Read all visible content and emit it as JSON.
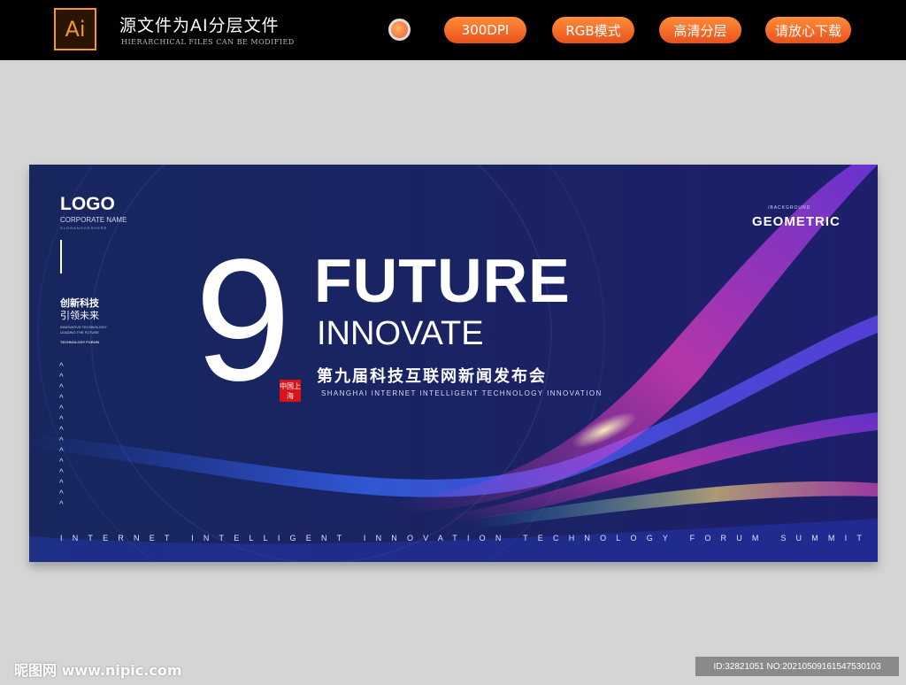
{
  "topbar": {
    "ai_icon_label": "Ai",
    "title": "源文件为AI分层文件",
    "subtitle": "HIERARCHICAL FILES CAN BE MODIFIED",
    "pills": [
      "300DPI",
      "RGB模式",
      "高清分层",
      "请放心下载"
    ]
  },
  "banner": {
    "logo": "LOGO",
    "corporate_name": "CORPORATE NAME",
    "slogan": "SLOGANGOESHERE",
    "cn_line1": "创新科技",
    "cn_line2": "引领未来",
    "small_line1": "INNOVATIVE TECHNOLOGY",
    "small_line2": "LEADING THE FUTURE",
    "small_line3": "TECHNOLOGY FORUM",
    "number": "9",
    "headline": "FUTURE",
    "subheadline": "INNOVATE",
    "cn_title": "第九届科技互联网新闻发布会",
    "en_subtitle": "SHANGHAI INTERNET INTELLIGENT TECHNOLOGY INNOVATION",
    "seal_text": "中国上海",
    "bg_label": "/BACKGROUND",
    "geometric": "GEOMETRIC",
    "bottom_line": "INTERNET INTELLIGENT INNOVATION TECHNOLOGY FORUM SUMMIT",
    "chevron": "^"
  },
  "footer": {
    "watermark": "昵图网 www.nipic.com",
    "id_text": "ID:32821051 NO:20210509161547530103"
  },
  "colors": {
    "accent_orange": "#f05a28",
    "banner_blue": "#1a2363"
  }
}
